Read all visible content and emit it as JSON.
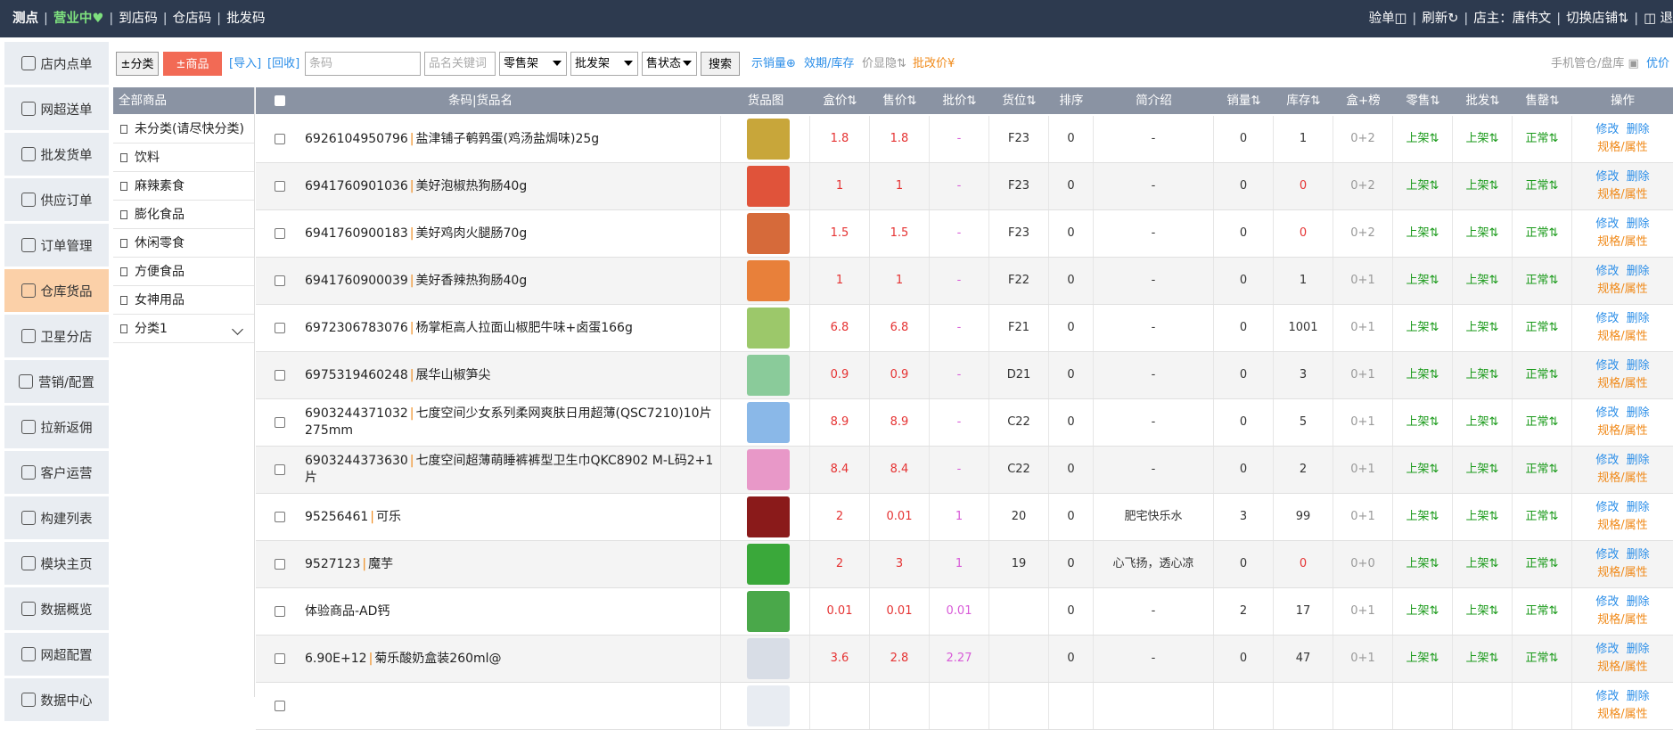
{
  "topbar": {
    "brand": "测点",
    "status": "营业中♥",
    "links": [
      "到店码",
      "仓店码",
      "批发码"
    ],
    "right": [
      "验单◫",
      "刷新↻",
      "店主：唐伟文",
      "切换店铺⇅",
      "◫ 退"
    ]
  },
  "sidebar": {
    "items": [
      {
        "label": "店内点单",
        "icon": "house-icon"
      },
      {
        "label": "网超送单",
        "icon": "delivery-icon"
      },
      {
        "label": "批发货单",
        "icon": "database-icon"
      },
      {
        "label": "供应订单",
        "icon": "database-icon"
      },
      {
        "label": "订单管理",
        "icon": "clipboard-icon"
      },
      {
        "label": "仓库货品",
        "icon": "warehouse-icon"
      },
      {
        "label": "卫星分店",
        "icon": "network-icon"
      },
      {
        "label": "营销/配置",
        "icon": "settings-icon"
      },
      {
        "label": "拉新返佣",
        "icon": "checklist-icon"
      },
      {
        "label": "客户运营",
        "icon": "users-icon"
      },
      {
        "label": "构建列表",
        "icon": "house-icon"
      },
      {
        "label": "模块主页",
        "icon": "house-icon"
      },
      {
        "label": "数据概览",
        "icon": "chart-icon"
      },
      {
        "label": "网超配置",
        "icon": "chart-icon"
      },
      {
        "label": "数据中心",
        "icon": "globe-icon"
      }
    ]
  },
  "toolbar": {
    "category_btn": "±分类",
    "goods_btn": "±商品",
    "import": "[导入]",
    "recycle": "[回收]",
    "barcode_placeholder": "条码",
    "keyword_placeholder": "品名关键词",
    "select_retail": "零售架",
    "select_wholesale": "批发架",
    "select_status": "售状态",
    "search_btn": "搜索",
    "show_sales": "示销量⊕",
    "expiry_stock": "效期/库存",
    "price_hidden": "价显隐⇅",
    "wholesale_edit": "批改价¥",
    "mobile_inventory": "手机管仓/盘库 ▣",
    "coupon": "优价"
  },
  "categories": {
    "header": "全部商品",
    "items": [
      "未分类(请尽快分类)",
      "饮料",
      "麻辣素食",
      "膨化食品",
      "休闲零食",
      "方便食品",
      "女神用品",
      "分类1"
    ]
  },
  "table": {
    "headers": [
      "条码|货品名",
      "货品图",
      "盒价⇅",
      "售价⇅",
      "批价⇅",
      "货位⇅",
      "排序",
      "简介绍",
      "销量⇅",
      "库存⇅",
      "盒+榜",
      "零售⇅",
      "批发⇅",
      "售罄⇅",
      "操作"
    ],
    "rows": [
      {
        "code": "6926104950796",
        "name": "盐津铺子鹌鹑蛋(鸡汤盐焗味)25g",
        "box": "1.8",
        "sale": "1.8",
        "whole": "-",
        "loc": "F23",
        "sort": "0",
        "intro": "-",
        "sold": "0",
        "stock": "1",
        "bb": "0+2",
        "retail": "上架⇅",
        "wholesale": "上架⇅",
        "soldout": "正常⇅",
        "img_color": "#c8a63a"
      },
      {
        "code": "6941760901036",
        "name": "美好泡椒热狗肠40g",
        "box": "1",
        "sale": "1",
        "whole": "-",
        "loc": "F23",
        "sort": "0",
        "intro": "-",
        "sold": "0",
        "stock": "0",
        "bb": "0+2",
        "retail": "上架⇅",
        "wholesale": "上架⇅",
        "soldout": "正常⇅",
        "img_color": "#e0533a"
      },
      {
        "code": "6941760900183",
        "name": "美好鸡肉火腿肠70g",
        "box": "1.5",
        "sale": "1.5",
        "whole": "-",
        "loc": "F23",
        "sort": "0",
        "intro": "-",
        "sold": "0",
        "stock": "0",
        "bb": "0+2",
        "retail": "上架⇅",
        "wholesale": "上架⇅",
        "soldout": "正常⇅",
        "img_color": "#d66a3a"
      },
      {
        "code": "6941760900039",
        "name": "美好香辣热狗肠40g",
        "box": "1",
        "sale": "1",
        "whole": "-",
        "loc": "F22",
        "sort": "0",
        "intro": "-",
        "sold": "0",
        "stock": "1",
        "bb": "0+1",
        "retail": "上架⇅",
        "wholesale": "上架⇅",
        "soldout": "正常⇅",
        "img_color": "#e8803a"
      },
      {
        "code": "6972306783076",
        "name": "杨掌柜高人拉面山椒肥牛味+卤蛋166g",
        "box": "6.8",
        "sale": "6.8",
        "whole": "-",
        "loc": "F21",
        "sort": "0",
        "intro": "-",
        "sold": "0",
        "stock": "1001",
        "bb": "0+1",
        "retail": "上架⇅",
        "wholesale": "上架⇅",
        "soldout": "正常⇅",
        "img_color": "#9cc86a"
      },
      {
        "code": "6975319460248",
        "name": "展华山椒笋尖",
        "box": "0.9",
        "sale": "0.9",
        "whole": "-",
        "loc": "D21",
        "sort": "0",
        "intro": "-",
        "sold": "0",
        "stock": "3",
        "bb": "0+1",
        "retail": "上架⇅",
        "wholesale": "上架⇅",
        "soldout": "正常⇅",
        "img_color": "#8acb9a"
      },
      {
        "code": "6903244371032",
        "name": "七度空间少女系列柔网爽肤日用超薄(QSC7210)10片275mm",
        "box": "8.9",
        "sale": "8.9",
        "whole": "-",
        "loc": "C22",
        "sort": "0",
        "intro": "-",
        "sold": "0",
        "stock": "5",
        "bb": "0+1",
        "retail": "上架⇅",
        "wholesale": "上架⇅",
        "soldout": "正常⇅",
        "img_color": "#8ab8e8"
      },
      {
        "code": "6903244373630",
        "name": "七度空间超薄萌睡裤裤型卫生巾QKC8902 M-L码2+1片",
        "box": "8.4",
        "sale": "8.4",
        "whole": "-",
        "loc": "C22",
        "sort": "0",
        "intro": "-",
        "sold": "0",
        "stock": "2",
        "bb": "0+1",
        "retail": "上架⇅",
        "wholesale": "上架⇅",
        "soldout": "正常⇅",
        "img_color": "#e898c8"
      },
      {
        "code": "95256461",
        "name": "可乐",
        "box": "2",
        "sale": "0.01",
        "whole": "1",
        "loc": "20",
        "sort": "0",
        "intro": "肥宅快乐水",
        "sold": "3",
        "stock": "99",
        "bb": "0+1",
        "retail": "上架⇅",
        "wholesale": "上架⇅",
        "soldout": "正常⇅",
        "img_color": "#8a1a1a"
      },
      {
        "code": "9527123",
        "name": "魔芋",
        "box": "2",
        "sale": "3",
        "whole": "1",
        "loc": "19",
        "sort": "0",
        "intro": "心飞扬，透心凉",
        "sold": "0",
        "stock": "0",
        "bb": "0+0",
        "retail": "上架⇅",
        "wholesale": "上架⇅",
        "soldout": "正常⇅",
        "img_color": "#3aa83a"
      },
      {
        "code": "",
        "name": "体验商品-AD钙",
        "box": "0.01",
        "sale": "0.01",
        "whole": "0.01",
        "loc": "",
        "sort": "0",
        "intro": "-",
        "sold": "2",
        "stock": "17",
        "bb": "0+1",
        "retail": "上架⇅",
        "wholesale": "上架⇅",
        "soldout": "正常⇅",
        "img_color": "#4aa84a"
      },
      {
        "code": "6.90E+12",
        "name": "菊乐酸奶盒装260ml@",
        "box": "3.6",
        "sale": "2.8",
        "whole": "2.27",
        "loc": "",
        "sort": "0",
        "intro": "-",
        "sold": "0",
        "stock": "47",
        "bb": "0+1",
        "retail": "上架⇅",
        "wholesale": "上架⇅",
        "soldout": "正常⇅",
        "img_color": "#d8dde6"
      },
      {
        "code": "",
        "name": "",
        "box": "",
        "sale": "",
        "whole": "",
        "loc": "",
        "sort": "",
        "intro": "",
        "sold": "",
        "stock": "",
        "bb": "",
        "retail": "",
        "wholesale": "",
        "soldout": "",
        "img_color": "#e8ecf2"
      }
    ],
    "op_edit": "修改",
    "op_delete": "删除",
    "op_spec": "规格/属性"
  },
  "colors": {
    "topbar": "#2d3a4f",
    "accent_red": "#f26a55",
    "link_blue": "#2b8ee8",
    "green": "#1a9a1a",
    "orange": "#f08a1a",
    "sidebar_active": "#fbd0a8",
    "table_header": "#8a93a3"
  }
}
